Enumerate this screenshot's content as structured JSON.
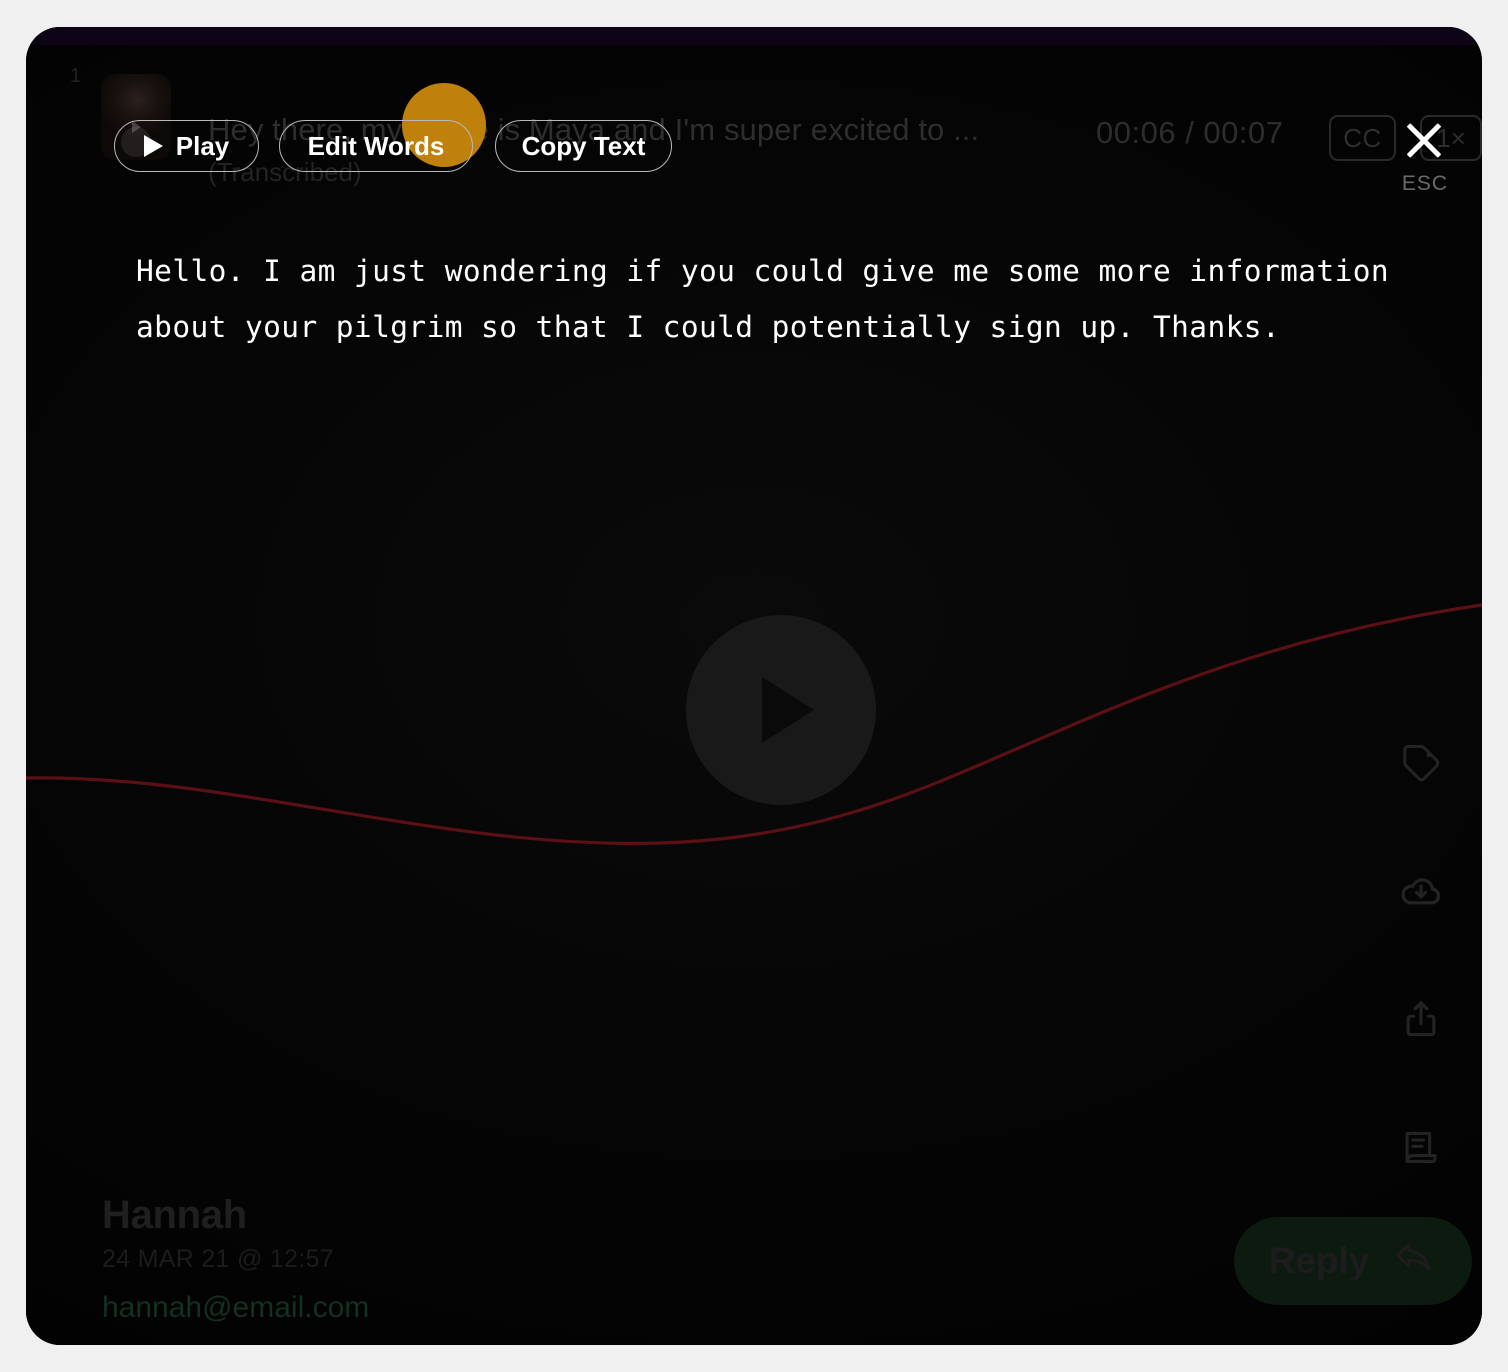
{
  "window": {
    "background_color": "#f0f0f0",
    "panel_color": "#050505",
    "accent_color": "#c8860c"
  },
  "background_message": {
    "index": "1",
    "thumbnail_icon": "person-thumbnail",
    "preview_text": "Hey there, my name is Maya and I'm super excited to ...",
    "status_label": "(Transcribed)",
    "time_display": "00:06 / 00:07",
    "cc_label": "CC",
    "speed_label": "1×"
  },
  "close": {
    "icon": "close-x-icon",
    "shortcut_label": "ESC"
  },
  "toolbar": {
    "play_label": "Play",
    "play_icon": "play-triangle-icon",
    "edit_words_label": "Edit Words",
    "copy_text_label": "Copy Text"
  },
  "transcript": {
    "text": "Hello. I am just wondering if you could give me some more information about your pilgrim so that I could potentially sign up. Thanks."
  },
  "player": {
    "center_play_icon": "play-triangle-icon",
    "waveform_color": "#5a1015"
  },
  "rail": {
    "items": [
      {
        "icon": "tag-icon",
        "name": "tag"
      },
      {
        "icon": "cloud-download-icon",
        "name": "download"
      },
      {
        "icon": "share-icon",
        "name": "share"
      },
      {
        "icon": "transcript-icon",
        "name": "transcript"
      }
    ]
  },
  "contact": {
    "name": "Hannah",
    "date": "24 MAR 21 @ 12:57",
    "email": "hannah@email.com"
  },
  "reply": {
    "label": "Reply",
    "icon": "reply-arrow-icon"
  }
}
